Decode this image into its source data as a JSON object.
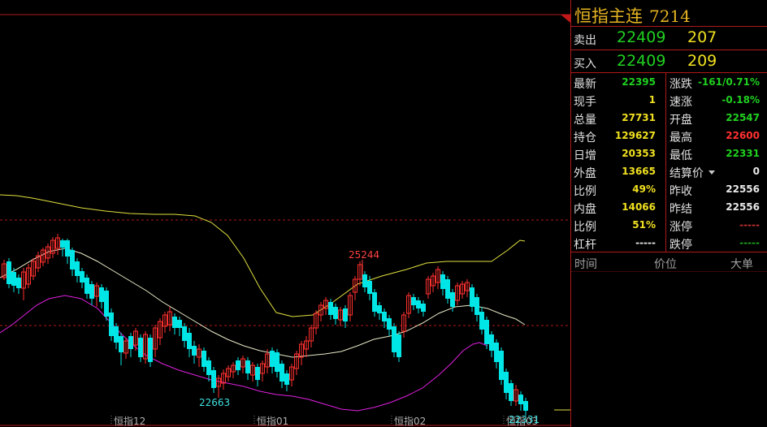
{
  "quote": {
    "name": "恒指主连",
    "code": "7214",
    "sell_label": "卖出",
    "sell_price": "22409",
    "sell_volume": "207",
    "buy_label": "买入",
    "buy_price": "22409",
    "buy_volume": "209"
  },
  "stats": [
    {
      "k1": "最新",
      "v1": "22395",
      "c1": "green",
      "k2": "涨跌",
      "v2": "-161/0.71%",
      "c2": "green"
    },
    {
      "k1": "现手",
      "v1": "1",
      "c1": "yellow",
      "k2": "速涨",
      "v2": "-0.18%",
      "c2": "green"
    },
    {
      "k1": "总量",
      "v1": "27731",
      "c1": "yellow",
      "k2": "开盘",
      "v2": "22547",
      "c2": "green"
    },
    {
      "k1": "持仓",
      "v1": "129627",
      "c1": "yellow",
      "k2": "最高",
      "v2": "22600",
      "c2": "red"
    },
    {
      "k1": "日增",
      "v1": "20353",
      "c1": "yellow",
      "k2": "最低",
      "v2": "22331",
      "c2": "green"
    },
    {
      "k1": "外盘",
      "v1": "13665",
      "c1": "yellow",
      "k2": "结算价",
      "v2": "0",
      "c2": "white"
    },
    {
      "k1": "比例",
      "v1": "49%",
      "c1": "yellow",
      "k2": "昨收",
      "v2": "22556",
      "c2": "white"
    },
    {
      "k1": "内盘",
      "v1": "14066",
      "c1": "yellow",
      "k2": "昨结",
      "v2": "22556",
      "c2": "white"
    },
    {
      "k1": "比例",
      "v1": "51%",
      "c1": "yellow",
      "k2": "涨停",
      "v2": "-----",
      "c2": "redd"
    },
    {
      "k1": "杠杆",
      "v1": "-----",
      "c1": "white",
      "k2": "跌停",
      "v2": "-----",
      "c2": "greend"
    }
  ],
  "ticks_header": {
    "time": "时间",
    "price": "价位",
    "big": "大单"
  },
  "chart": {
    "high_label": "25244",
    "low_label": "22663",
    "last_low_label": "22331",
    "months": [
      "恒指12",
      "恒指01",
      "恒指02",
      "恒指03"
    ],
    "colors": {
      "up": "#ff3030",
      "down": "#00e5e5",
      "mid": "#e8e8c8",
      "upper": "#e0e040",
      "lower": "#e020e0"
    }
  }
}
